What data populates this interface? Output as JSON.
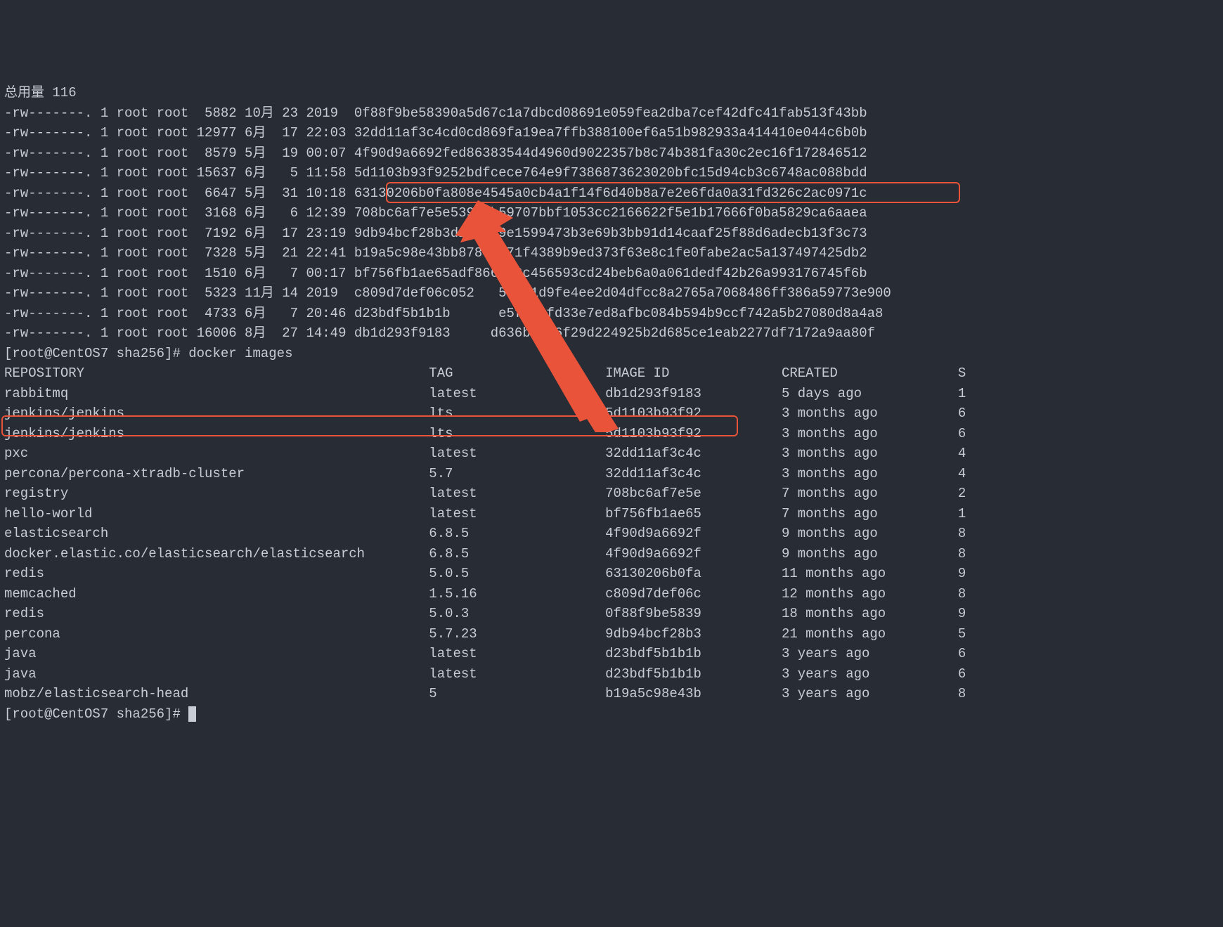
{
  "totalUsage": "总用量 116",
  "files": [
    {
      "perm": "-rw-------.",
      "n": "1",
      "user": "root",
      "grp": "root",
      "size": "5882",
      "mon": "10月",
      "day": "23",
      "time": "2019",
      "hash": "0f88f9be58390a5d67c1a7dbcd08691e059fea2dba7cef42dfc41fab513f43bb"
    },
    {
      "perm": "-rw-------.",
      "n": "1",
      "user": "root",
      "grp": "root",
      "size": "12977",
      "mon": "6月",
      "day": "17",
      "time": "22:03",
      "hash": "32dd11af3c4cd0cd869fa19ea7ffb388100ef6a51b982933a414410e044c6b0b"
    },
    {
      "perm": "-rw-------.",
      "n": "1",
      "user": "root",
      "grp": "root",
      "size": "8579",
      "mon": "5月",
      "day": "19",
      "time": "00:07",
      "hash": "4f90d9a6692fed86383544d4960d9022357b8c74b381fa30c2ec16f172846512"
    },
    {
      "perm": "-rw-------.",
      "n": "1",
      "user": "root",
      "grp": "root",
      "size": "15637",
      "mon": "6月",
      "day": "5",
      "time": "11:58",
      "hash": "5d1103b93f9252bdfcece764e9f7386873623020bfc15d94cb3c6748ac088bdd"
    },
    {
      "perm": "-rw-------.",
      "n": "1",
      "user": "root",
      "grp": "root",
      "size": "6647",
      "mon": "5月",
      "day": "31",
      "time": "10:18",
      "hash": "63130206b0fa808e4545a0cb4a1f14f6d40b8a7e2e6fda0a31fd326c2ac0971c"
    },
    {
      "perm": "-rw-------.",
      "n": "1",
      "user": "root",
      "grp": "root",
      "size": "3168",
      "mon": "6月",
      "day": "6",
      "time": "12:39",
      "hash": "708bc6af7e5e539bdb59707bbf1053cc2166622f5e1b17666f0ba5829ca6aaea"
    },
    {
      "perm": "-rw-------.",
      "n": "1",
      "user": "root",
      "grp": "root",
      "size": "7192",
      "mon": "6月",
      "day": "17",
      "time": "23:19",
      "hash": "9db94bcf28b3d10ac89e1599473b3e69b3bb91d14caaf25f88d6adecb13f3c73"
    },
    {
      "perm": "-rw-------.",
      "n": "1",
      "user": "root",
      "grp": "root",
      "size": "7328",
      "mon": "5月",
      "day": "21",
      "time": "22:41",
      "hash": "b19a5c98e43bb87849b71f4389b9ed373f63e8c1fe0fabe2ac5a137497425db2"
    },
    {
      "perm": "-rw-------.",
      "n": "1",
      "user": "root",
      "grp": "root",
      "size": "1510",
      "mon": "6月",
      "day": "7",
      "time": "00:17",
      "hash": "bf756fb1ae65adf866bd8c456593cd24beb6a0a061dedf42b26a993176745f6b"
    },
    {
      "perm": "-rw-------.",
      "n": "1",
      "user": "root",
      "grp": "root",
      "size": "5323",
      "mon": "11月",
      "day": "14",
      "time": "2019",
      "hash": "c809d7def06c052   5b9a1d9fe4ee2d04dfcc8a2765a7068486ff386a59773e900"
    },
    {
      "perm": "-rw-------.",
      "n": "1",
      "user": "root",
      "grp": "root",
      "size": "4733",
      "mon": "6月",
      "day": "7",
      "time": "20:46",
      "hash": "d23bdf5b1b1b      e5f1d0fd33e7ed8afbc084b594b9ccf742a5b27080d8a4a8"
    },
    {
      "perm": "-rw-------.",
      "n": "1",
      "user": "root",
      "grp": "root",
      "size": "16006",
      "mon": "8月",
      "day": "27",
      "time": "14:49",
      "hash": "db1d293f9183     d636ba1c6f29d224925b2d685ce1eab2277df7172a9aa80f"
    }
  ],
  "prompt1": "[root@CentOS7 sha256]# docker images",
  "header": {
    "repo": "REPOSITORY",
    "tag": "TAG",
    "id": "IMAGE ID",
    "created": "CREATED",
    "size": "S"
  },
  "images": [
    {
      "repo": "rabbitmq",
      "tag": "latest",
      "id": "db1d293f9183",
      "created": "5 days ago",
      "size": "1"
    },
    {
      "repo": "jenkins/jenkins",
      "tag": "lts",
      "id": "5d1103b93f92",
      "created": "3 months ago",
      "size": "6"
    },
    {
      "repo": "jenkins/jenkins",
      "tag": "lts",
      "id": "5d1103b93f92",
      "created": "3 months ago",
      "size": "6"
    },
    {
      "repo": "pxc",
      "tag": "latest",
      "id": "32dd11af3c4c",
      "created": "3 months ago",
      "size": "4"
    },
    {
      "repo": "percona/percona-xtradb-cluster",
      "tag": "5.7",
      "id": "32dd11af3c4c",
      "created": "3 months ago",
      "size": "4"
    },
    {
      "repo": "registry",
      "tag": "latest",
      "id": "708bc6af7e5e",
      "created": "7 months ago",
      "size": "2"
    },
    {
      "repo": "hello-world",
      "tag": "latest",
      "id": "bf756fb1ae65",
      "created": "7 months ago",
      "size": "1"
    },
    {
      "repo": "elasticsearch",
      "tag": "6.8.5",
      "id": "4f90d9a6692f",
      "created": "9 months ago",
      "size": "8"
    },
    {
      "repo": "docker.elastic.co/elasticsearch/elasticsearch",
      "tag": "6.8.5",
      "id": "4f90d9a6692f",
      "created": "9 months ago",
      "size": "8"
    },
    {
      "repo": "redis",
      "tag": "5.0.5",
      "id": "63130206b0fa",
      "created": "11 months ago",
      "size": "9"
    },
    {
      "repo": "memcached",
      "tag": "1.5.16",
      "id": "c809d7def06c",
      "created": "12 months ago",
      "size": "8"
    },
    {
      "repo": "redis",
      "tag": "5.0.3",
      "id": "0f88f9be5839",
      "created": "18 months ago",
      "size": "9"
    },
    {
      "repo": "percona",
      "tag": "5.7.23",
      "id": "9db94bcf28b3",
      "created": "21 months ago",
      "size": "5"
    },
    {
      "repo": "java",
      "tag": "latest",
      "id": "d23bdf5b1b1b",
      "created": "3 years ago",
      "size": "6"
    },
    {
      "repo": "java",
      "tag": "latest",
      "id": "d23bdf5b1b1b",
      "created": "3 years ago",
      "size": "6"
    },
    {
      "repo": "mobz/elasticsearch-head",
      "tag": "5",
      "id": "b19a5c98e43b",
      "created": "3 years ago",
      "size": "8"
    }
  ],
  "prompt2": "[root@CentOS7 sha256]# "
}
